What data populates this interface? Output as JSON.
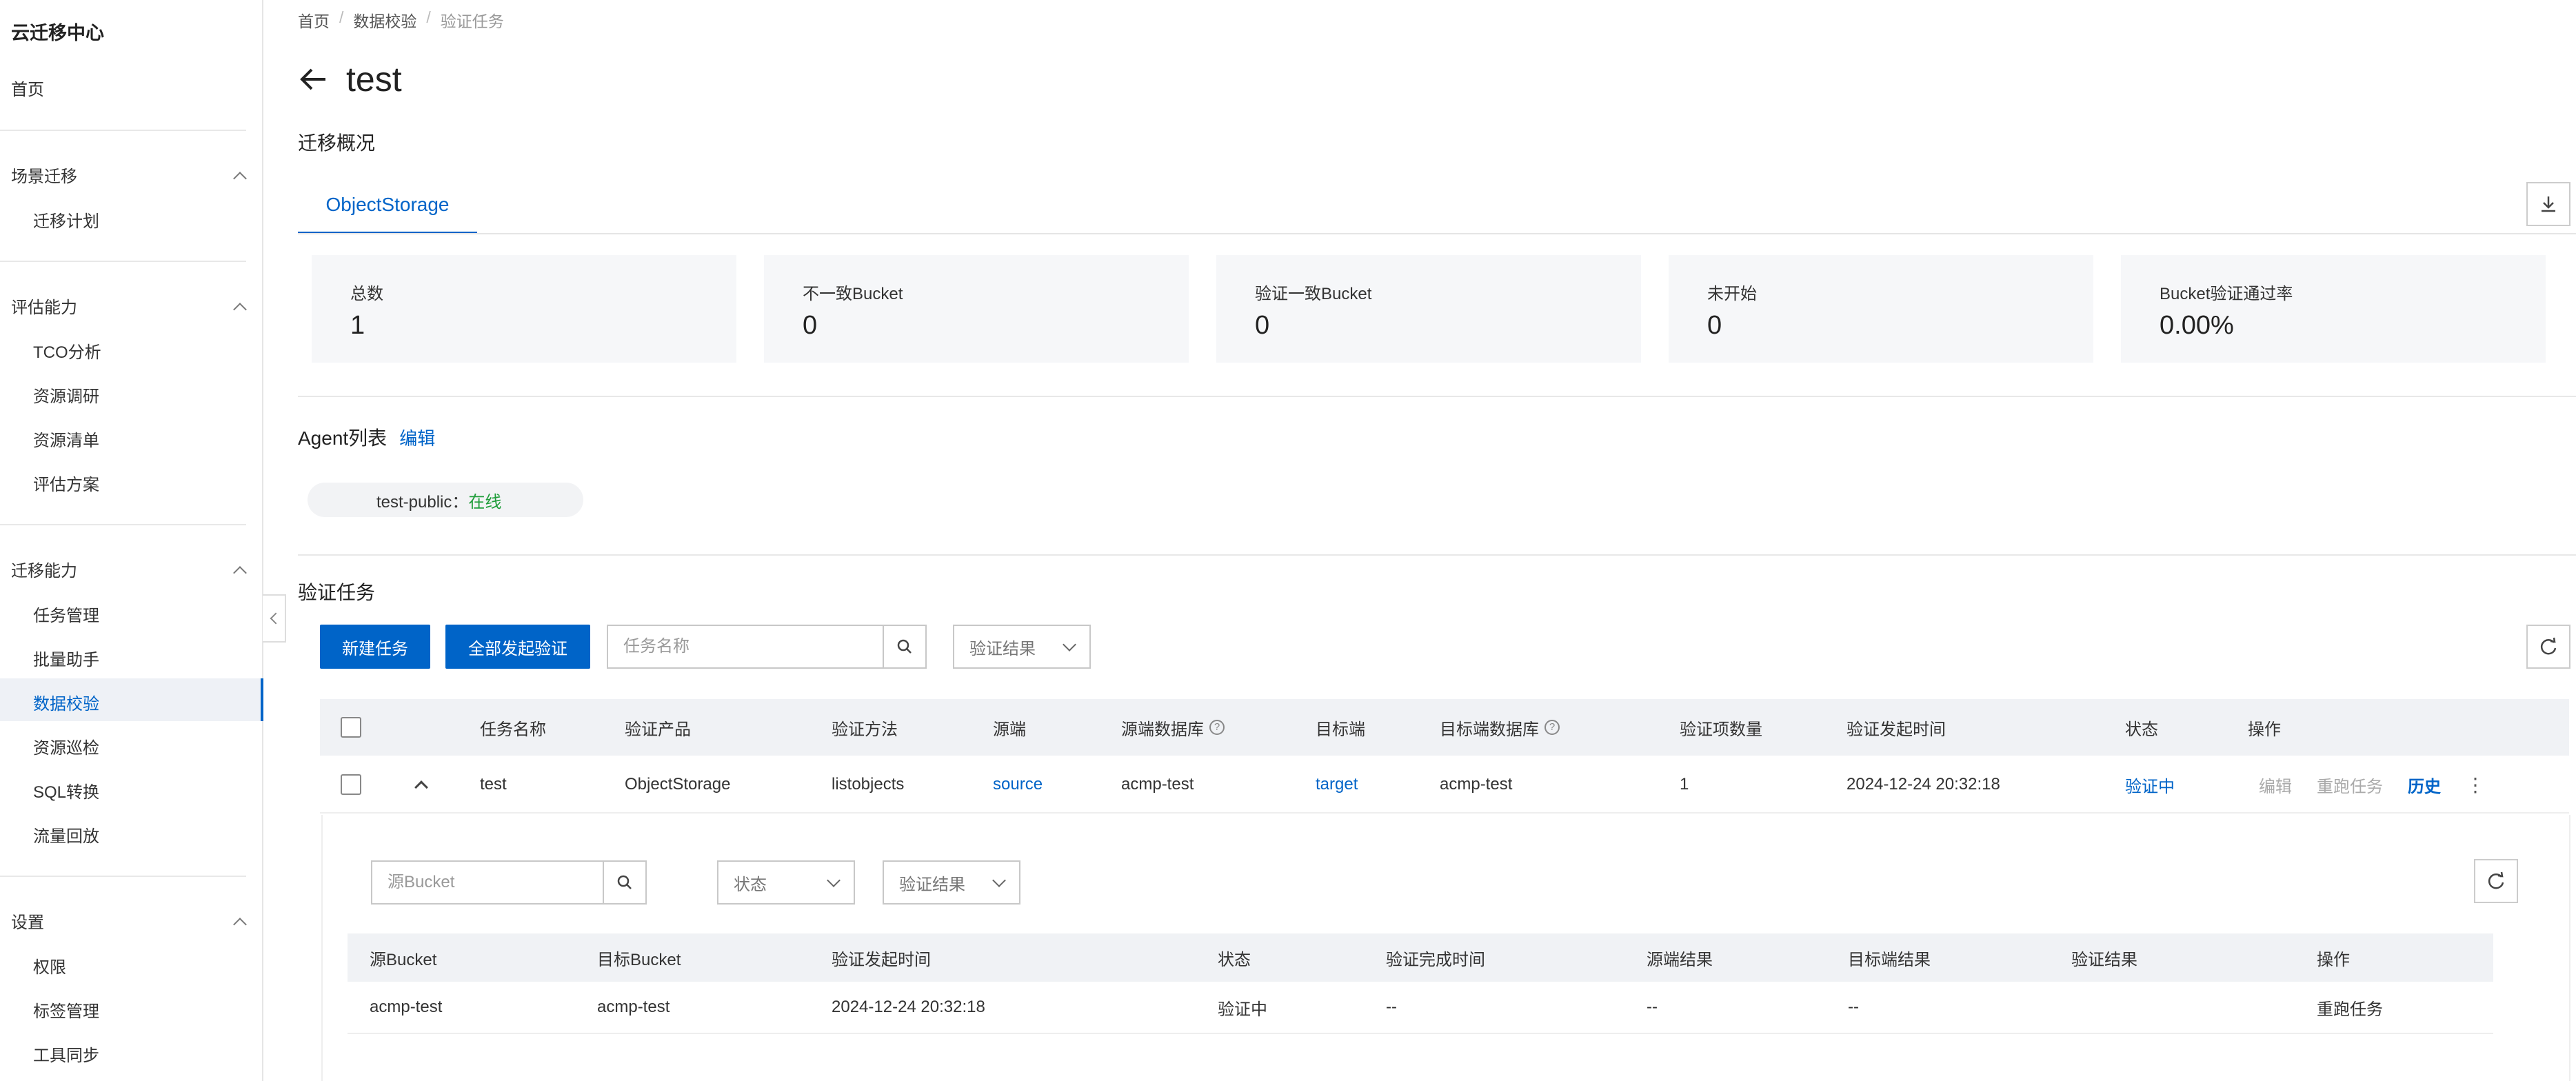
{
  "sidebar": {
    "title": "云迁移中心",
    "home": "首页",
    "groups": [
      {
        "label": "场景迁移",
        "items": [
          "迁移计划"
        ]
      },
      {
        "label": "评估能力",
        "items": [
          "TCO分析",
          "资源调研",
          "资源清单",
          "评估方案"
        ]
      },
      {
        "label": "迁移能力",
        "items": [
          "任务管理",
          "批量助手",
          "数据校验",
          "资源巡检",
          "SQL转换",
          "流量回放"
        ]
      },
      {
        "label": "设置",
        "items": [
          "权限",
          "标签管理",
          "工具同步"
        ]
      }
    ]
  },
  "breadcrumb": [
    "首页",
    "数据校验",
    "验证任务"
  ],
  "page": {
    "title": "test",
    "overview_title": "迁移概况",
    "tab": "ObjectStorage"
  },
  "stats": [
    {
      "label": "总数",
      "value": "1"
    },
    {
      "label": "不一致Bucket",
      "value": "0"
    },
    {
      "label": "验证一致Bucket",
      "value": "0"
    },
    {
      "label": "未开始",
      "value": "0"
    },
    {
      "label": "Bucket验证通过率",
      "value": "0.00%"
    }
  ],
  "agent": {
    "title": "Agent列表",
    "edit": "编辑",
    "name": "test-public：",
    "status": "在线"
  },
  "tasks": {
    "title": "验证任务",
    "new_button": "新建任务",
    "run_all_button": "全部发起验证",
    "search_placeholder": "任务名称",
    "result_filter": "验证结果",
    "columns": [
      "任务名称",
      "验证产品",
      "验证方法",
      "源端",
      "源端数据库",
      "目标端",
      "目标端数据库",
      "验证项数量",
      "验证发起时间",
      "状态",
      "操作"
    ],
    "row": {
      "name": "test",
      "product": "ObjectStorage",
      "method": "listobjects",
      "source": "source",
      "source_db": "acmp-test",
      "target": "target",
      "target_db": "acmp-test",
      "count": "1",
      "time": "2024-12-24 20:32:18",
      "status": "验证中",
      "op_edit": "编辑",
      "op_rerun": "重跑任务",
      "op_history": "历史"
    }
  },
  "sub": {
    "search_placeholder": "源Bucket",
    "status_filter": "状态",
    "result_filter": "验证结果",
    "columns": [
      "源Bucket",
      "目标Bucket",
      "验证发起时间",
      "状态",
      "验证完成时间",
      "源端结果",
      "目标端结果",
      "验证结果",
      "操作"
    ],
    "row": {
      "source_bucket": "acmp-test",
      "target_bucket": "acmp-test",
      "start_time": "2024-12-24 20:32:18",
      "status": "验证中",
      "finish_time": "--",
      "source_result": "--",
      "target_result": "--",
      "verify_result": "",
      "op": "重跑任务"
    }
  }
}
